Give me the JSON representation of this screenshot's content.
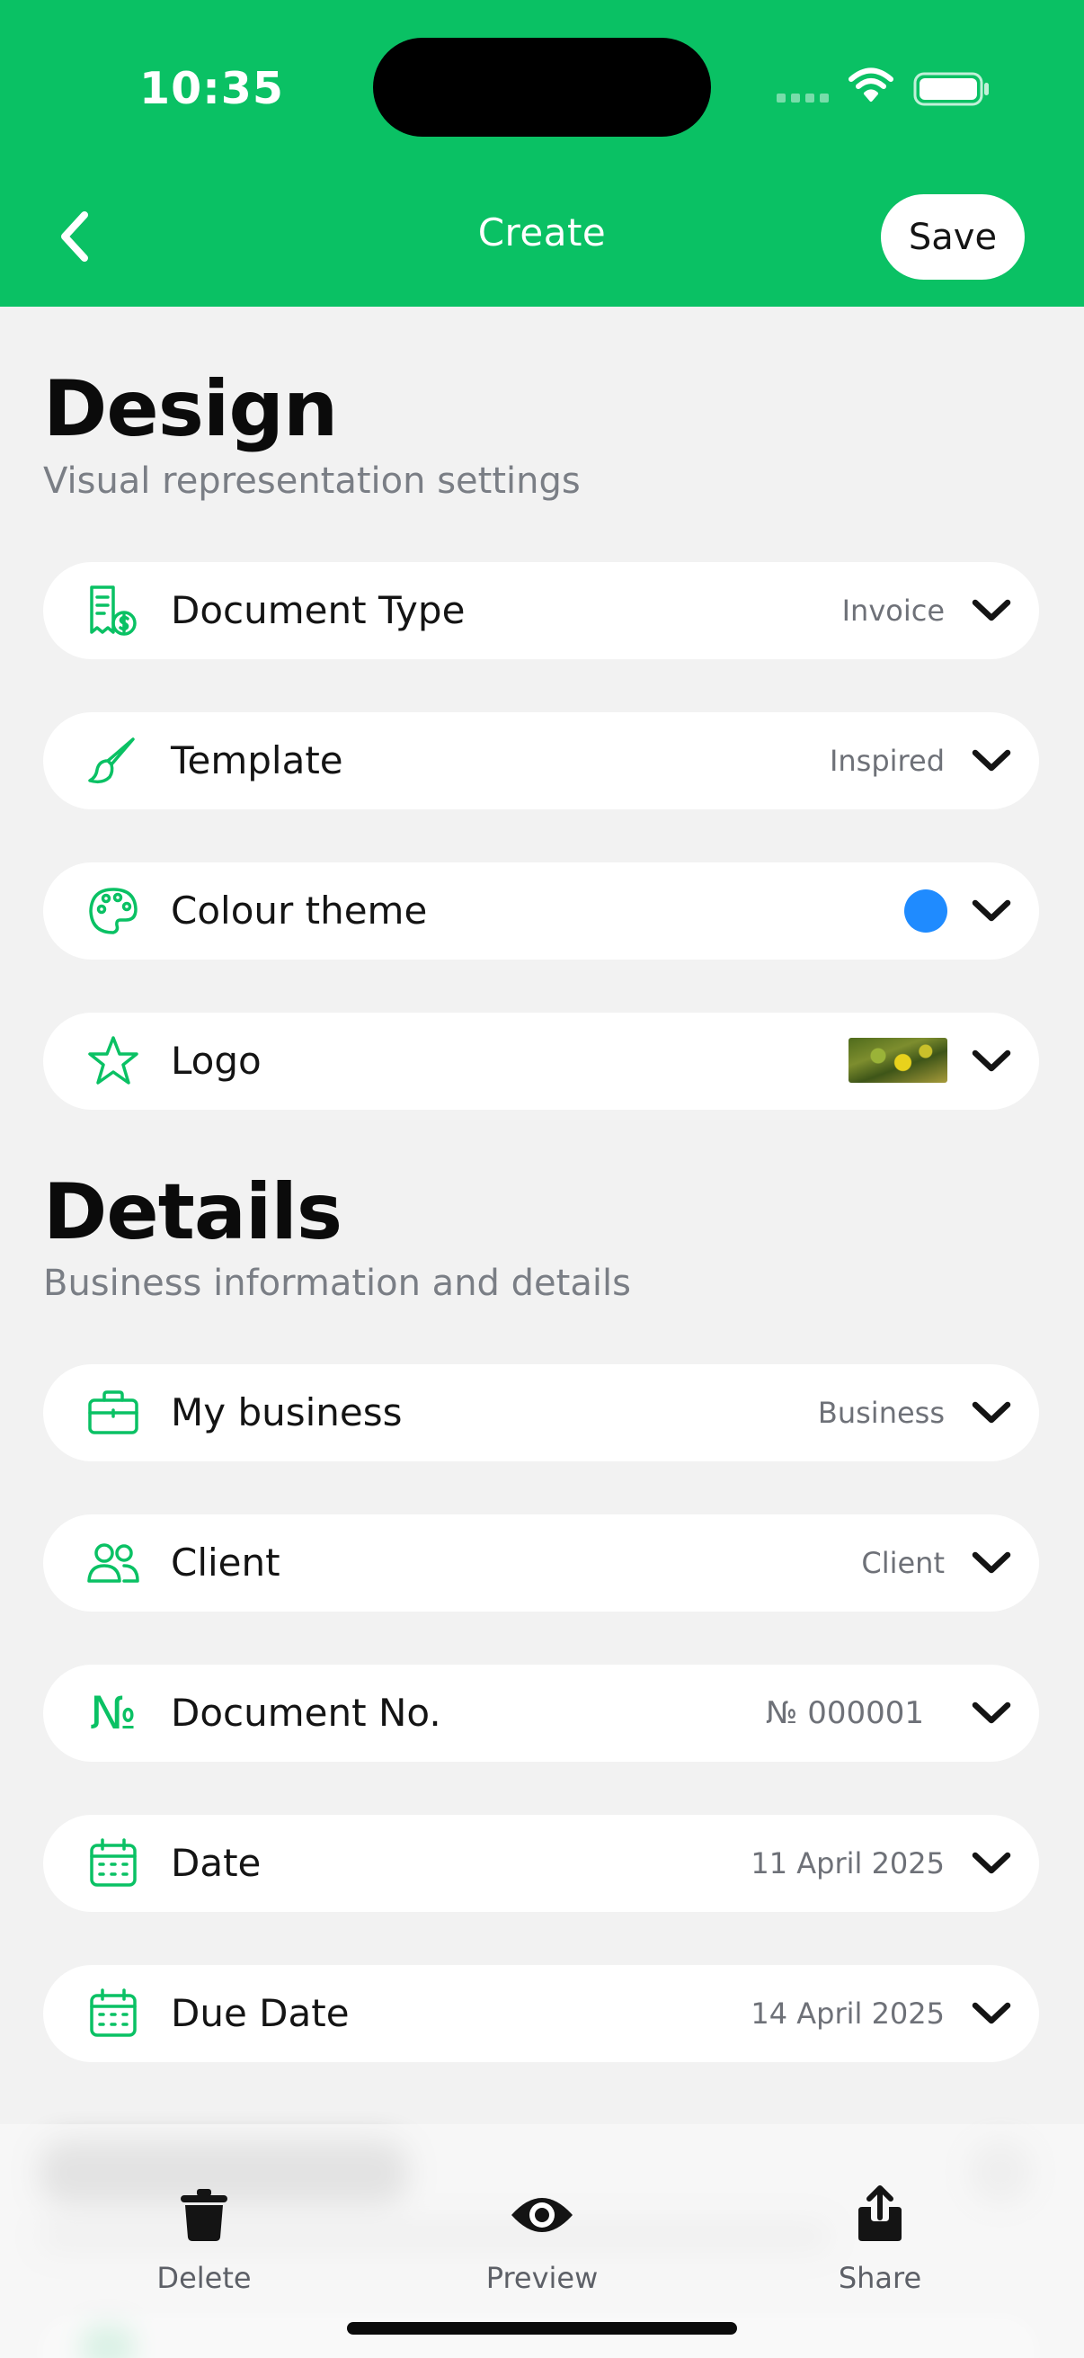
{
  "status_bar": {
    "time": "10:35"
  },
  "header": {
    "title": "Create",
    "save_label": "Save",
    "background_color": "#0ac164"
  },
  "design": {
    "title": "Design",
    "subtitle": "Visual representation settings",
    "rows": [
      {
        "icon": "receipt-dollar-icon",
        "label": "Document Type",
        "value": "Invoice"
      },
      {
        "icon": "paintbrush-icon",
        "label": "Template",
        "value": "Inspired"
      },
      {
        "icon": "palette-icon",
        "label": "Colour theme",
        "value_color": "#1f8bff"
      },
      {
        "icon": "star-icon",
        "label": "Logo",
        "value_image": "logo-thumbnail"
      }
    ]
  },
  "details": {
    "title": "Details",
    "subtitle": "Business information and details",
    "rows": [
      {
        "icon": "briefcase-icon",
        "label": "My business",
        "value": "Business"
      },
      {
        "icon": "users-icon",
        "label": "Client",
        "value": "Client"
      },
      {
        "icon": "numero-icon",
        "icon_glyph": "№",
        "label": "Document No.",
        "value": "№ 000001"
      },
      {
        "icon": "calendar-icon",
        "label": "Date",
        "value": "11 April 2025"
      },
      {
        "icon": "calendar-icon",
        "label": "Due Date",
        "value": "14 April 2025"
      }
    ]
  },
  "tabbar": {
    "items": [
      {
        "icon": "trash-icon",
        "label": "Delete"
      },
      {
        "icon": "eye-icon",
        "label": "Preview"
      },
      {
        "icon": "share-icon",
        "label": "Share"
      }
    ]
  },
  "colors": {
    "accent_green": "#0ac164",
    "theme_dot": "#1f8bff",
    "background": "#f2f2f2"
  }
}
